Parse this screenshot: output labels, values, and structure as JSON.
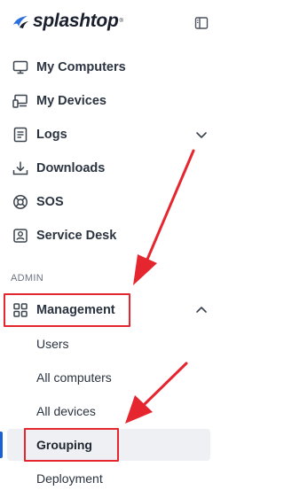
{
  "brand": {
    "name": "splashtop",
    "trademark": "®"
  },
  "header": {
    "collapse_icon": "sidebar-collapse-icon"
  },
  "nav": {
    "my_computers": {
      "label": "My Computers",
      "icon": "monitor-icon"
    },
    "my_devices": {
      "label": "My Devices",
      "icon": "devices-icon"
    },
    "logs": {
      "label": "Logs",
      "icon": "log-icon",
      "expanded": false
    },
    "downloads": {
      "label": "Downloads",
      "icon": "download-icon"
    },
    "sos": {
      "label": "SOS",
      "icon": "lifebuoy-icon"
    },
    "service_desk": {
      "label": "Service Desk",
      "icon": "service-desk-icon"
    }
  },
  "admin": {
    "section_label": "ADMIN",
    "management": {
      "label": "Management",
      "icon": "grid-icon",
      "expanded": true,
      "items": [
        {
          "label": "Users"
        },
        {
          "label": "All computers"
        },
        {
          "label": "All devices"
        },
        {
          "label": "Grouping",
          "active": true
        },
        {
          "label": "Deployment"
        }
      ]
    }
  },
  "colors": {
    "accent": "#1a5fd6",
    "annotation": "#e5262f",
    "active_bg": "#eef0f3",
    "text": "#2b3440",
    "brand_blue": "#2a6fdb"
  }
}
